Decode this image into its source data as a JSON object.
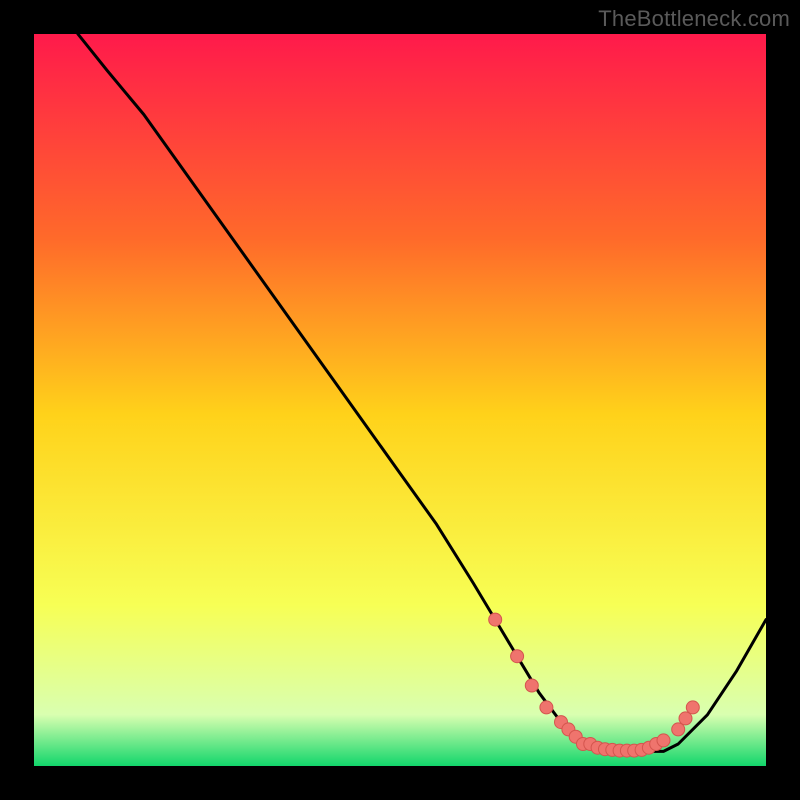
{
  "watermark": "TheBottleneck.com",
  "gradient": {
    "top": "#ff1a4b",
    "q1": "#ff6a2a",
    "mid": "#ffd21a",
    "q3": "#f7ff55",
    "near_bottom": "#d9ffb0",
    "bottom": "#12d66b"
  },
  "curve_color": "#000000",
  "dot_fill": "#ef746d",
  "dot_stroke": "#d4554e",
  "chart_data": {
    "type": "line",
    "title": "",
    "xlabel": "",
    "ylabel": "",
    "xlim": [
      0,
      100
    ],
    "ylim": [
      0,
      100
    ],
    "x": [
      6,
      10,
      15,
      20,
      25,
      30,
      35,
      40,
      45,
      50,
      55,
      60,
      63,
      66,
      69,
      72,
      75,
      78,
      80,
      82,
      84,
      86,
      88,
      92,
      96,
      100
    ],
    "y": [
      100,
      95,
      89,
      82,
      75,
      68,
      61,
      54,
      47,
      40,
      33,
      25,
      20,
      15,
      10,
      6,
      3,
      2,
      2,
      2,
      2,
      2,
      3,
      7,
      13,
      20
    ],
    "dots_x": [
      63,
      66,
      68,
      70,
      72,
      73,
      74,
      75,
      76,
      77,
      78,
      79,
      80,
      81,
      82,
      83,
      84,
      85,
      86,
      88,
      89,
      90
    ],
    "dots_y": [
      20,
      15,
      11,
      8,
      6,
      5,
      4,
      3,
      3,
      2.5,
      2.3,
      2.2,
      2.1,
      2.1,
      2.1,
      2.2,
      2.5,
      3,
      3.5,
      5,
      6.5,
      8
    ]
  }
}
